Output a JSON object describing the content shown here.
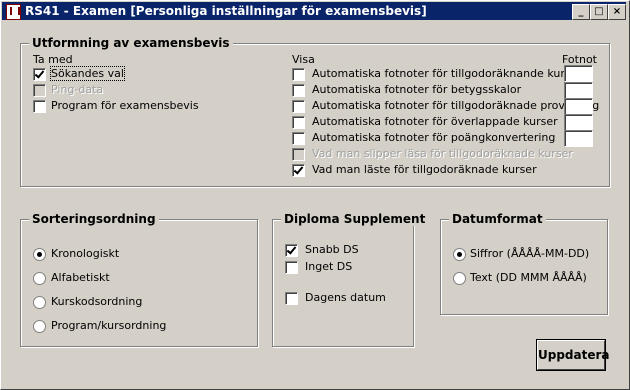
{
  "window": {
    "title": "RS41 - Examen [Personliga inställningar för examensbevis]",
    "btn_min": "_",
    "btn_max": "□",
    "btn_close": "×"
  },
  "utformning": {
    "title": "Utformning av examensbevis",
    "ta_med_label": "Ta med",
    "visa_label": "Visa",
    "fotnot_label": "Fotnot",
    "ta_med": [
      {
        "label": "Sökandes val",
        "checked": true,
        "enabled": true
      },
      {
        "label": "Ping-data",
        "checked": false,
        "enabled": false
      },
      {
        "label": "Program för examensbevis",
        "checked": false,
        "enabled": true
      }
    ],
    "visa": [
      {
        "label": "Automatiska fotnoter för tillgodoräknande kurser",
        "checked": false,
        "enabled": true,
        "fotnot": ""
      },
      {
        "label": "Automatiska fotnoter för betygsskalor",
        "checked": false,
        "enabled": true,
        "fotnot": ""
      },
      {
        "label": "Automatiska fotnoter för tillgodoräknade provpoäng",
        "checked": false,
        "enabled": true,
        "fotnot": ""
      },
      {
        "label": "Automatiska fotnoter för överlappade kurser",
        "checked": false,
        "enabled": true,
        "fotnot": ""
      },
      {
        "label": "Automatiska fotnoter för poängkonvertering",
        "checked": false,
        "enabled": true,
        "fotnot": ""
      },
      {
        "label": "Vad man slipper läsa för tillgodoräknade kurser",
        "checked": false,
        "enabled": false
      },
      {
        "label": "Vad man läste för tillgodoräknade kurser",
        "checked": true,
        "enabled": true
      }
    ]
  },
  "sortering": {
    "title": "Sorteringsordning",
    "options": [
      {
        "label": "Kronologiskt",
        "selected": true
      },
      {
        "label": "Alfabetiskt",
        "selected": false
      },
      {
        "label": "Kurskodsordning",
        "selected": false
      },
      {
        "label": "Program/kursordning",
        "selected": false
      }
    ]
  },
  "diploma": {
    "title": "Diploma Supplement",
    "options": [
      {
        "label": "Snabb DS",
        "checked": true
      },
      {
        "label": "Inget DS",
        "checked": false
      },
      {
        "label": "Dagens datum",
        "checked": false
      }
    ]
  },
  "datum": {
    "title": "Datumformat",
    "options": [
      {
        "label": "Siffror (ÅÅÅÅ-MM-DD)",
        "selected": true
      },
      {
        "label": "Text (DD MMM ÅÅÅÅ)",
        "selected": false
      }
    ]
  },
  "buttons": {
    "update": "Uppdatera"
  }
}
